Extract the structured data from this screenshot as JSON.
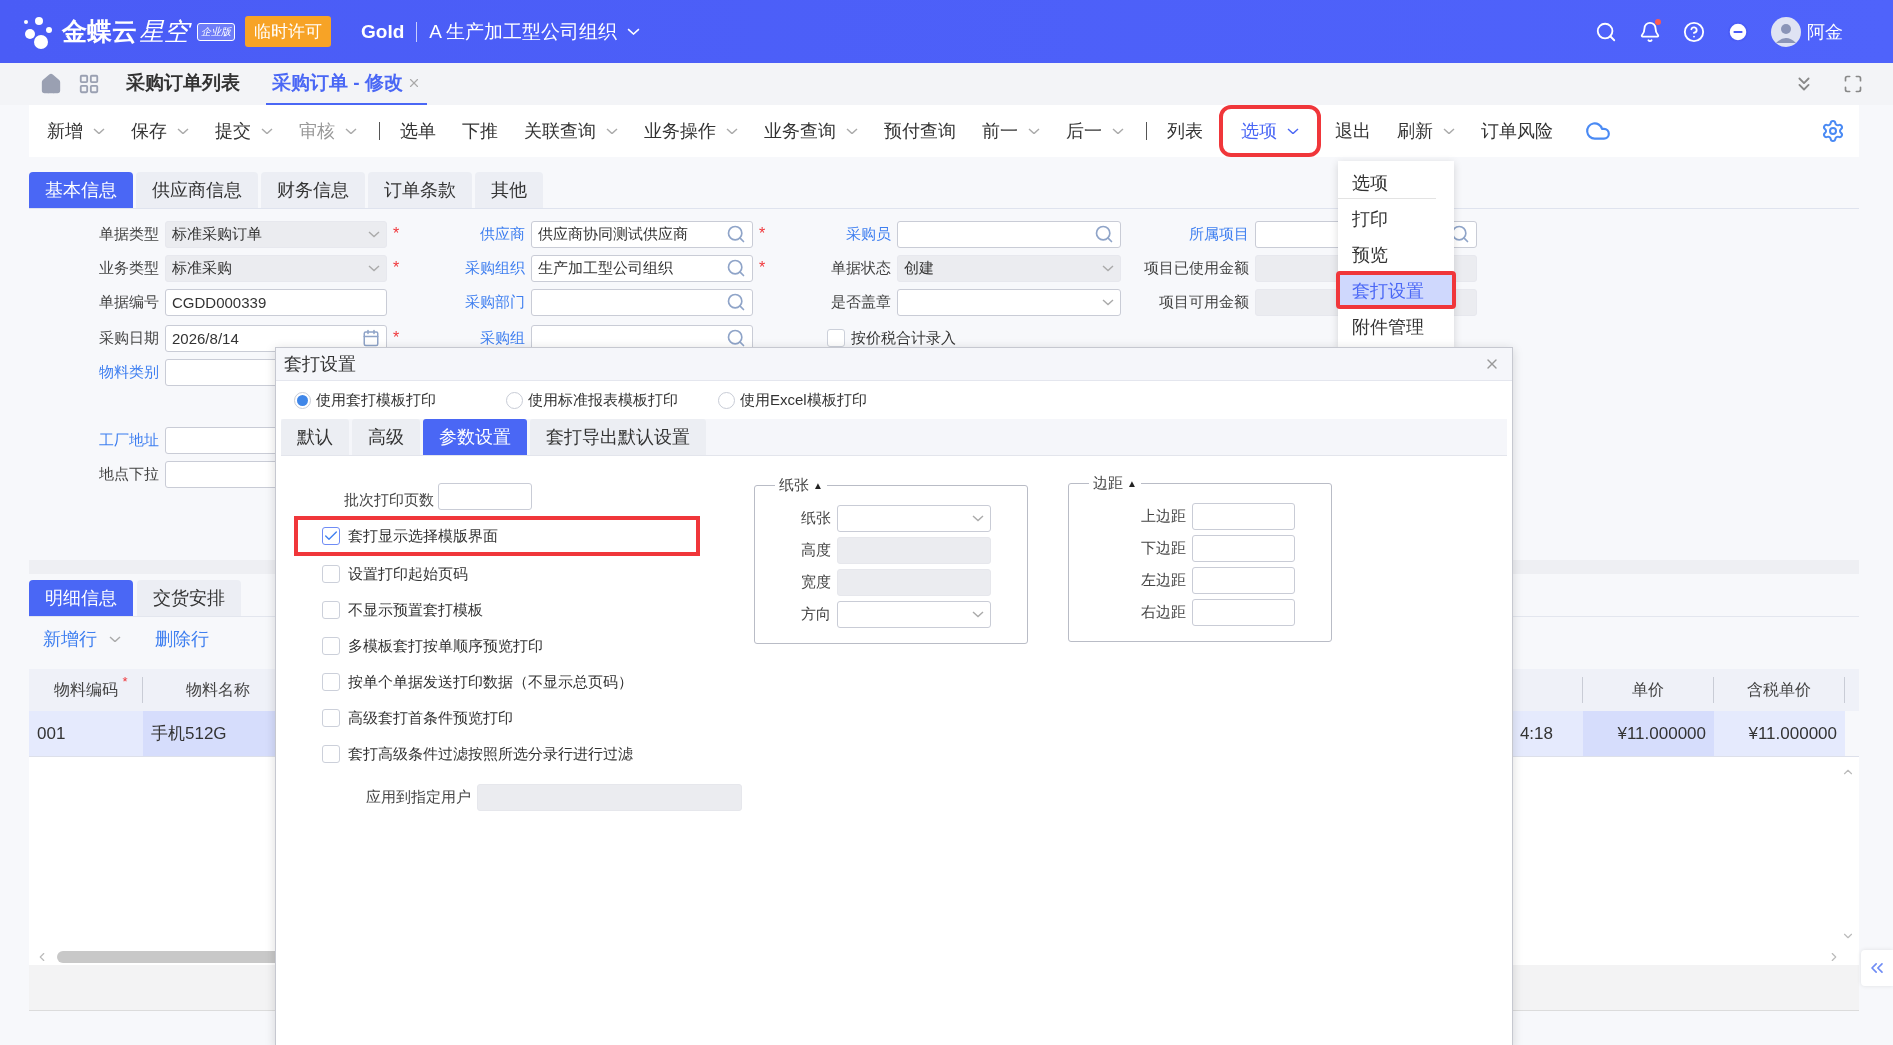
{
  "header": {
    "brand": "金蝶云",
    "product": "星空",
    "edition": "企业版",
    "license_badge": "临时许可",
    "tenant": "Gold",
    "org": "A 生产加工型公司组织",
    "user": "阿金",
    "notification_dot": true
  },
  "page_tabs": [
    {
      "label": "采购订单列表",
      "selected": false,
      "closable": false
    },
    {
      "label": "采购订单 - 修改",
      "selected": true,
      "closable": true
    }
  ],
  "toolbar": [
    {
      "kind": "button",
      "label": "新增",
      "dropdown": true,
      "disabled": false,
      "open": false,
      "highlighted": false
    },
    {
      "kind": "button",
      "label": "保存",
      "dropdown": true,
      "disabled": false,
      "open": false,
      "highlighted": false
    },
    {
      "kind": "button",
      "label": "提交",
      "dropdown": true,
      "disabled": false,
      "open": false,
      "highlighted": false
    },
    {
      "kind": "button",
      "label": "审核",
      "dropdown": true,
      "disabled": true,
      "open": false,
      "highlighted": false
    },
    {
      "kind": "separator"
    },
    {
      "kind": "button",
      "label": "选单",
      "dropdown": false,
      "disabled": false,
      "open": false,
      "highlighted": false
    },
    {
      "kind": "button",
      "label": "下推",
      "dropdown": false,
      "disabled": false,
      "open": false,
      "highlighted": false
    },
    {
      "kind": "button",
      "label": "关联查询",
      "dropdown": true,
      "disabled": false,
      "open": false,
      "highlighted": false
    },
    {
      "kind": "button",
      "label": "业务操作",
      "dropdown": true,
      "disabled": false,
      "open": false,
      "highlighted": false
    },
    {
      "kind": "button",
      "label": "业务查询",
      "dropdown": true,
      "disabled": false,
      "open": false,
      "highlighted": false
    },
    {
      "kind": "button",
      "label": "预付查询",
      "dropdown": false,
      "disabled": false,
      "open": false,
      "highlighted": false
    },
    {
      "kind": "button",
      "label": "前一",
      "dropdown": true,
      "disabled": false,
      "open": false,
      "highlighted": false
    },
    {
      "kind": "button",
      "label": "后一",
      "dropdown": true,
      "disabled": false,
      "open": false,
      "highlighted": false
    },
    {
      "kind": "separator"
    },
    {
      "kind": "button",
      "label": "列表",
      "dropdown": false,
      "disabled": false,
      "open": false,
      "highlighted": false
    },
    {
      "kind": "button",
      "label": "选项",
      "dropdown": true,
      "disabled": false,
      "open": true,
      "highlighted": true
    },
    {
      "kind": "button",
      "label": "退出",
      "dropdown": false,
      "disabled": false,
      "open": false,
      "highlighted": false
    },
    {
      "kind": "button",
      "label": "刷新",
      "dropdown": true,
      "disabled": false,
      "open": false,
      "highlighted": false
    },
    {
      "kind": "button",
      "label": "订单风险",
      "dropdown": false,
      "disabled": false,
      "open": false,
      "highlighted": false
    },
    {
      "kind": "cloud"
    }
  ],
  "section_tabs": [
    {
      "label": "基本信息",
      "selected": true
    },
    {
      "label": "供应商信息",
      "selected": false
    },
    {
      "label": "财务信息",
      "selected": false
    },
    {
      "label": "订单条款",
      "selected": false
    },
    {
      "label": "其他",
      "selected": false
    }
  ],
  "form": {
    "rows": [
      [
        {
          "label": "单据类型",
          "link": false,
          "kind": "select",
          "value": "标准采购订单",
          "readonly": true,
          "required_mark": "*"
        },
        {
          "label": "供应商",
          "link": true,
          "kind": "search",
          "value": "供应商协同测试供应商",
          "readonly": false,
          "required_mark": "*"
        },
        {
          "label": "采购员",
          "link": true,
          "kind": "search",
          "readonly": false
        },
        {
          "label": "所属项目",
          "link": true,
          "kind": "search",
          "readonly": false
        }
      ],
      [
        {
          "label": "业务类型",
          "link": false,
          "kind": "select",
          "value": "标准采购",
          "readonly": true,
          "required_mark": "*"
        },
        {
          "label": "采购组织",
          "link": true,
          "kind": "search",
          "value": "生产加工型公司组织",
          "readonly": false,
          "required_mark": "*"
        },
        {
          "label": "单据状态",
          "link": false,
          "kind": "select",
          "value": "创建",
          "readonly": true
        },
        {
          "label": "项目已使用金额",
          "link": false,
          "kind": "text",
          "readonly": true
        }
      ],
      [
        {
          "label": "单据编号",
          "link": false,
          "kind": "text",
          "value": "CGDD000339",
          "readonly": false
        },
        {
          "label": "采购部门",
          "link": true,
          "kind": "search",
          "readonly": false
        },
        {
          "label": "是否盖章",
          "link": false,
          "kind": "select",
          "readonly": false
        },
        {
          "label": "项目可用金额",
          "link": false,
          "kind": "text",
          "readonly": true
        }
      ],
      [
        {
          "label": "采购日期",
          "link": false,
          "kind": "date",
          "value": "2026/8/14",
          "readonly": false,
          "required_mark": "*"
        },
        {
          "label": "采购组",
          "link": true,
          "kind": "search",
          "readonly": false
        },
        {
          "label": "按价税合计录入",
          "kind": "checkbox",
          "checked": false
        }
      ],
      [
        {
          "label": "物料类别",
          "link": true,
          "kind": "text",
          "readonly": false
        }
      ]
    ],
    "address_fields": [
      {
        "label": "工厂地址",
        "link": true,
        "kind": "text",
        "readonly": false
      },
      {
        "label": "地点下拉",
        "link": false,
        "kind": "text",
        "readonly": false
      }
    ]
  },
  "options_menu": {
    "items": [
      {
        "label": "选项",
        "selected": false,
        "highlighted": false
      },
      {
        "label": "打印",
        "selected": false,
        "highlighted": false
      },
      {
        "label": "预览",
        "selected": false,
        "highlighted": false
      },
      {
        "label": "套打设置",
        "selected": true,
        "highlighted": true
      },
      {
        "label": "附件管理",
        "selected": false,
        "highlighted": false
      }
    ]
  },
  "detail": {
    "tabs": [
      {
        "label": "明细信息",
        "selected": true
      },
      {
        "label": "交货安排",
        "selected": false
      }
    ],
    "actions": [
      {
        "label": "新增行",
        "dropdown": true
      },
      {
        "label": "删除行",
        "dropdown": false
      }
    ],
    "left_columns": [
      {
        "label": "物料编码",
        "required_mark": "*"
      },
      {
        "label": "物料名称"
      }
    ],
    "right_columns": [
      {
        "label": "单价"
      },
      {
        "label": "含税单价"
      }
    ],
    "row": {
      "left_cells": [
        "001",
        "手机512G"
      ],
      "right_cells": [
        "4:18",
        "¥11.000000",
        "¥11.000000"
      ]
    }
  },
  "dialog": {
    "title": "套打设置",
    "print_modes": [
      {
        "label": "使用套打模板打印",
        "selected": true
      },
      {
        "label": "使用标准报表模板打印",
        "selected": false
      },
      {
        "label": "使用Excel模板打印",
        "selected": false
      }
    ],
    "tabs": [
      {
        "label": "默认",
        "selected": false
      },
      {
        "label": "高级",
        "selected": false
      },
      {
        "label": "参数设置",
        "selected": true
      },
      {
        "label": "套打导出默认设置",
        "selected": false
      }
    ],
    "batch_pages_label": "批次打印页数",
    "options": [
      {
        "label": "套打显示选择模版界面",
        "checked": true,
        "highlighted": true
      },
      {
        "label": "设置打印起始页码",
        "checked": false,
        "highlighted": false
      },
      {
        "label": "不显示预置套打模板",
        "checked": false,
        "highlighted": false
      },
      {
        "label": "多模板套打按单顺序预览打印",
        "checked": false,
        "highlighted": false
      },
      {
        "label": "按单个单据发送打印数据（不显示总页码）",
        "checked": false,
        "highlighted": false
      },
      {
        "label": "高级套打首条件预览打印",
        "checked": false,
        "highlighted": false
      },
      {
        "label": "套打高级条件过滤按照所选分录行进行过滤",
        "checked": false,
        "highlighted": false
      }
    ],
    "apply_user_label": "应用到指定用户",
    "groups": [
      {
        "title": "纸张",
        "toggle": "▲",
        "fields": [
          {
            "label": "纸张",
            "kind": "select"
          },
          {
            "label": "高度",
            "kind": "readonly"
          },
          {
            "label": "宽度",
            "kind": "readonly"
          },
          {
            "label": "方向",
            "kind": "select"
          }
        ]
      },
      {
        "title": "边距",
        "toggle": "▲",
        "fields": [
          {
            "label": "上边距",
            "kind": "text"
          },
          {
            "label": "下边距",
            "kind": "text"
          },
          {
            "label": "左边距",
            "kind": "text"
          },
          {
            "label": "右边距",
            "kind": "text"
          }
        ]
      }
    ]
  }
}
